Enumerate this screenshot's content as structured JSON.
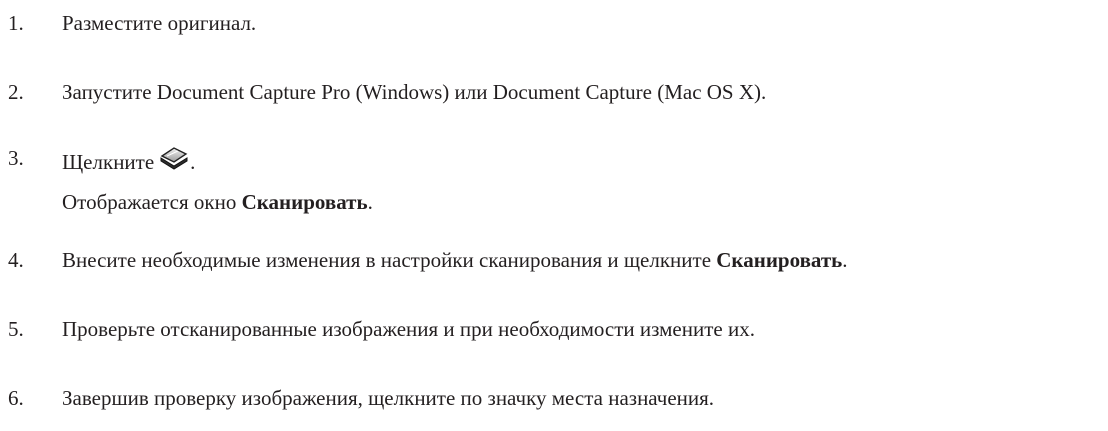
{
  "steps": [
    {
      "num": "1.",
      "text": "Разместите оригинал."
    },
    {
      "num": "2.",
      "text": "Запустите Document Capture Pro (Windows) или Document Capture (Mac OS X)."
    },
    {
      "num": "3.",
      "text_before": "Щелкните",
      "icon": "scanner-icon",
      "text_after": ".",
      "note_before": "Отображается окно ",
      "note_bold": "Сканировать",
      "note_after": "."
    },
    {
      "num": "4.",
      "text_before": "Внесите необходимые изменения в настройки сканирования и щелкните ",
      "text_bold": "Сканировать",
      "text_after": "."
    },
    {
      "num": "5.",
      "text": "Проверьте отсканированные изображения и при необходимости измените их."
    },
    {
      "num": "6.",
      "text": "Завершив проверку изображения, щелкните по значку места назначения."
    }
  ]
}
